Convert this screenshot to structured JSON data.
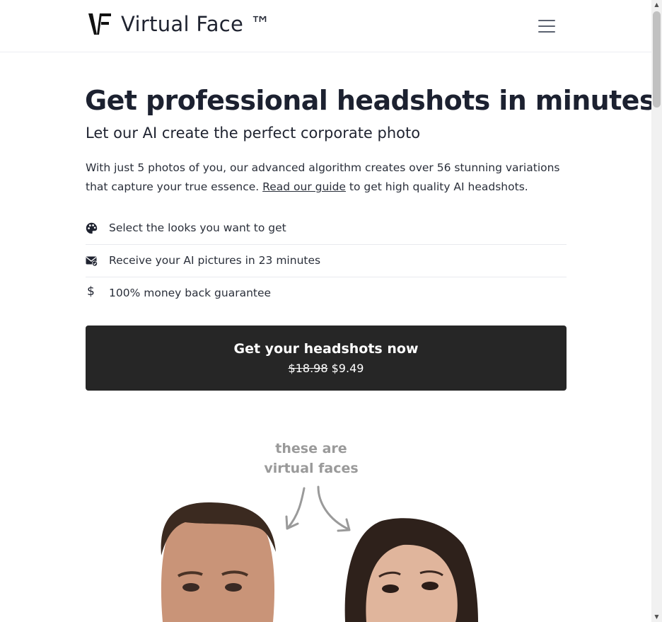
{
  "brand": {
    "name": "Virtual Face ™",
    "logo_icon": "vf-logo-icon"
  },
  "nav": {
    "menu_icon": "hamburger-menu-icon"
  },
  "hero": {
    "title": "Get professional headshots in minutes",
    "subtitle": "Let our AI create the perfect corporate photo",
    "body_before": "With just 5 photos of you, our advanced algorithm creates over 56 stunning variations that capture your true essence. ",
    "guide_link": "Read our guide",
    "body_after": " to get high quality AI headshots."
  },
  "features": [
    {
      "icon": "palette-icon",
      "text": "Select the looks you want to get"
    },
    {
      "icon": "envelope-check-icon",
      "text": "Receive your AI pictures in 23 minutes"
    },
    {
      "icon": "dollar-icon",
      "symbol": "$",
      "text": "100% money back guarantee"
    }
  ],
  "cta": {
    "label": "Get your headshots now",
    "old_price": "$18.98",
    "new_price": "$9.49"
  },
  "illustration": {
    "caption_line1": "these are",
    "caption_line2": "virtual faces"
  },
  "colors": {
    "text": "#1f2330",
    "cta_bg": "#262626",
    "cta_text": "#ffffff",
    "caption": "#9a9a9a"
  }
}
